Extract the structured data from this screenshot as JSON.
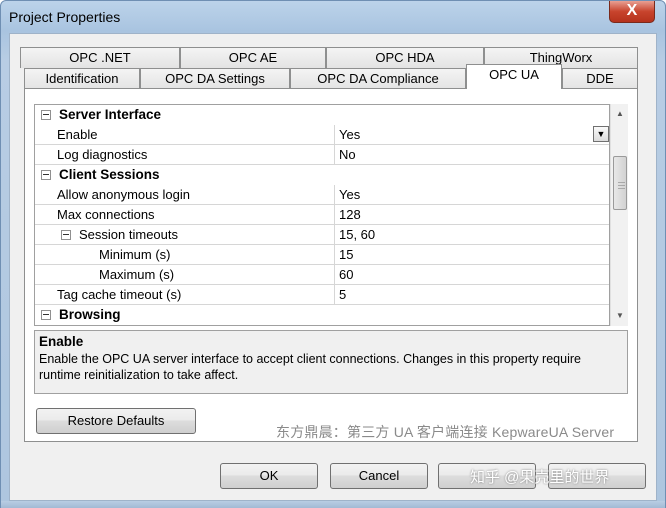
{
  "window": {
    "title": "Project Properties",
    "close_label": "X"
  },
  "tabs_row1": [
    "OPC .NET",
    "OPC AE",
    "OPC HDA",
    "ThingWorx"
  ],
  "tabs_row2": [
    "Identification",
    "OPC DA Settings",
    "OPC DA Compliance",
    "OPC UA",
    "DDE"
  ],
  "active_tab": "OPC UA",
  "grid": {
    "rows": [
      {
        "type": "category",
        "label": "Server Interface"
      },
      {
        "type": "prop",
        "label": "Enable",
        "value": "Yes",
        "dropdown": true,
        "selected": true
      },
      {
        "type": "prop",
        "label": "Log diagnostics",
        "value": "No"
      },
      {
        "type": "category",
        "label": "Client Sessions"
      },
      {
        "type": "prop",
        "label": "Allow anonymous login",
        "value": "Yes"
      },
      {
        "type": "prop",
        "label": "Max connections",
        "value": "128"
      },
      {
        "type": "group",
        "label": "Session timeouts",
        "value": "15, 60"
      },
      {
        "type": "sub",
        "label": "Minimum (s)",
        "value": "15"
      },
      {
        "type": "sub",
        "label": "Maximum (s)",
        "value": "60"
      },
      {
        "type": "prop",
        "label": "Tag cache timeout (s)",
        "value": "5"
      },
      {
        "type": "category",
        "label": "Browsing"
      }
    ]
  },
  "description": {
    "title": "Enable",
    "text": "Enable the OPC UA server interface to accept client connections.  Changes in this property require runtime reinitialization to take affect."
  },
  "buttons": {
    "restore": "Restore Defaults",
    "ok": "OK",
    "cancel": "Cancel",
    "apply": "",
    "help": ""
  },
  "watermarks": {
    "caption": "东方鼎晨：第三方 UA 客户端连接 KepwareUA Server",
    "zhihu": "知乎 @果壳里的世界"
  }
}
